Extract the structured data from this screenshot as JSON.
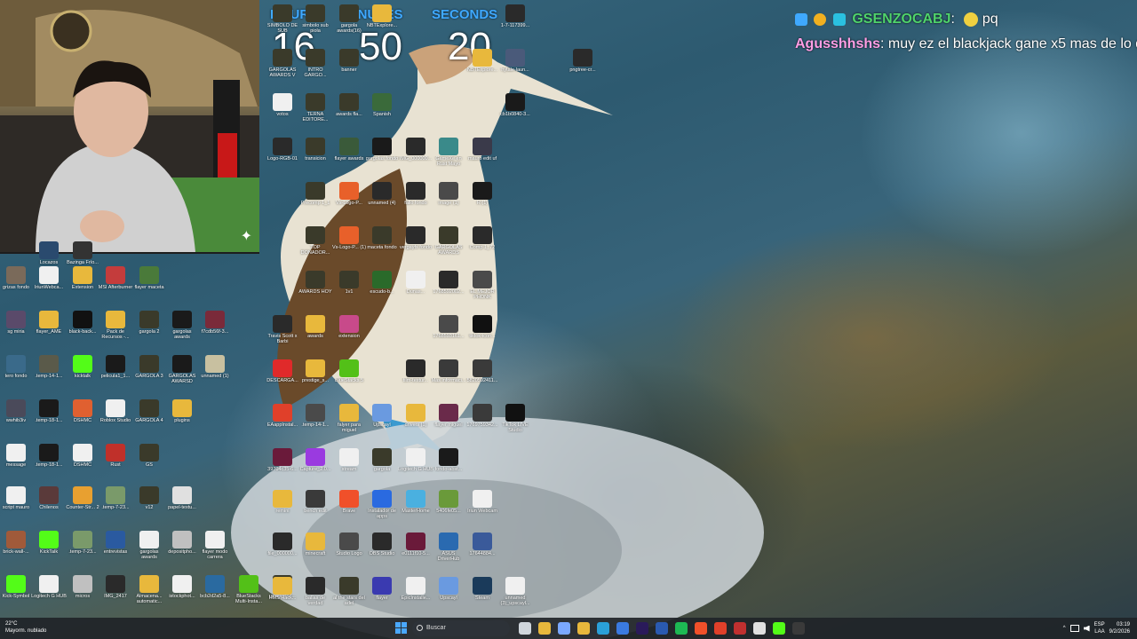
{
  "timer": {
    "hours_label": "HOURS",
    "minutes_label": "MINUTES",
    "seconds_label": "SECONDS",
    "hours": "16",
    "minutes": "50",
    "seconds": "20"
  },
  "chat": [
    {
      "user": "GSENZOCABJ",
      "sep": ":",
      "text": " pq",
      "badge_color": "#3fa9ff"
    },
    {
      "user": "Agusshhshs",
      "sep": ":",
      "text": " muy ez el blackjack gane x5 mas de lo que",
      "badge_color": ""
    }
  ],
  "webcam": {
    "sparkle": "✦"
  },
  "desktop_icons": [
    {
      "label": "Locazos",
      "color": "#2a4a6e"
    },
    {
      "label": "Bazinga Frío...",
      "color": "#333333"
    },
    {
      "label": "grizas fondo",
      "color": "#7a6a5a"
    },
    {
      "label": "IriunWebca...",
      "color": "#f0f0f0"
    },
    {
      "label": "Extension",
      "color": "#e8b83c"
    },
    {
      "label": "MSI Afterburner",
      "color": "#c43c3c"
    },
    {
      "label": "flayer maceta",
      "color": "#4a7a3a"
    },
    {
      "label": "sg miria",
      "color": "#5a4a6a"
    },
    {
      "label": "flayer_AME",
      "color": "#e8b83c"
    },
    {
      "label": "black-back...",
      "color": "#111111"
    },
    {
      "label": "Pack de Recursos -...",
      "color": "#e8b83c"
    },
    {
      "label": "gargola 2",
      "color": "#3a3a2a"
    },
    {
      "label": "gargolas awards",
      "color": "#1a1a1a"
    },
    {
      "label": "f7cdb56f-3...",
      "color": "#7a2a3a"
    },
    {
      "label": "tero fondo",
      "color": "#3a6a8a"
    },
    {
      "label": ".temp-14-1...",
      "color": "#5a5a4a"
    },
    {
      "label": "kicktalk",
      "color": "#53fc18"
    },
    {
      "label": "pelicula1_1...",
      "color": "#1a1a1a"
    },
    {
      "label": "GARGOLA 3",
      "color": "#3a3a2a"
    },
    {
      "label": "GARGOLAS AWARSD",
      "color": "#1a1a1a"
    },
    {
      "label": "unnamed (1)",
      "color": "#c8c0a0"
    },
    {
      "label": "wwhib3iv",
      "color": "#4a4a5a"
    },
    {
      "label": ".temp-18-1...",
      "color": "#1a1a1a"
    },
    {
      "label": "DSHMC",
      "color": "#e06030"
    },
    {
      "label": "Roblox Studio",
      "color": "#f0f0f0"
    },
    {
      "label": "GARGOLA 4",
      "color": "#3a3a2a"
    },
    {
      "label": "plugins",
      "color": "#e8b83c"
    },
    {
      "label": "message",
      "color": "#f0f0f0"
    },
    {
      "label": ".temp-18-1...",
      "color": "#1a1a1a"
    },
    {
      "label": "DSHMC",
      "color": "#f0f0f0"
    },
    {
      "label": "Rust",
      "color": "#c0302a"
    },
    {
      "label": "GS",
      "color": "#3a3a2a"
    },
    {
      "label": "script mauro",
      "color": "#f0f0f0"
    },
    {
      "label": "Chilenos",
      "color": "#5a3a3a"
    },
    {
      "label": "Counter-Str... 2",
      "color": "#e8a030"
    },
    {
      "label": ".temp-7-23...",
      "color": "#7a9a6a"
    },
    {
      "label": "v12",
      "color": "#3a3a2a"
    },
    {
      "label": "papel-textu...",
      "color": "#e0e0e0"
    },
    {
      "label": "brick-wall-...",
      "color": "#a05a3a"
    },
    {
      "label": "KickTalk",
      "color": "#53fc18"
    },
    {
      "label": ".temp-7-23...",
      "color": "#7a9a6a"
    },
    {
      "label": "entrevistas",
      "color": "#2a5aa0"
    },
    {
      "label": "gargolas awards",
      "color": "#f0f0f0"
    },
    {
      "label": "depositpho...",
      "color": "#c0c0c0"
    },
    {
      "label": "flayer modo carrera",
      "color": "#f0f0f0"
    },
    {
      "label": "Kick-Symbol",
      "color": "#53fc18"
    },
    {
      "label": "Logitech G HUB",
      "color": "#f0f0f0"
    },
    {
      "label": "micros",
      "color": "#c0c0c0"
    },
    {
      "label": "IMG_2417",
      "color": "#2a2a2a"
    },
    {
      "label": "Almacena... automatic...",
      "color": "#e8b83c"
    },
    {
      "label": "istockphot...",
      "color": "#f0f0f0"
    },
    {
      "label": "bcb2d2a5-8...",
      "color": "#2a6aa0"
    },
    {
      "label": "BlueStacks Multi-Insta...",
      "color": "#53c018"
    },
    {
      "label": "upscale_2...",
      "color": "#3a3a2a"
    },
    {
      "label": "SIMBOLO DE SUB",
      "color": "#3a3a2a"
    },
    {
      "label": "simbolo sub piola",
      "color": "#3a3a2a"
    },
    {
      "label": "gargola awards(16)",
      "color": "#3a3a2a"
    },
    {
      "label": "NBTExplore...",
      "color": "#e8b83c"
    },
    {
      "label": "1-7-117399...",
      "color": "#2a2a2a"
    },
    {
      "label": "GARGOLAS AWARDS V",
      "color": "#3a3a2a"
    },
    {
      "label": "INTRO GARGO...",
      "color": "#3a3a2a"
    },
    {
      "label": "banner",
      "color": "#3a3a2a"
    },
    {
      "label": "NBTExplore...",
      "color": "#e8b83c"
    },
    {
      "label": "hytale-laun...",
      "color": "#4a5a7a"
    },
    {
      "label": "pngtree-cr...",
      "color": "#2a2a2a"
    },
    {
      "label": "votos",
      "color": "#f0f0f0"
    },
    {
      "label": "TERNA EDITORE...",
      "color": "#3a3a2a"
    },
    {
      "label": "awards fla...",
      "color": "#3a3a2a"
    },
    {
      "label": "Spanish",
      "color": "#3a6a3a"
    },
    {
      "label": "cb1b0840-3...",
      "color": "#1a1a1a"
    },
    {
      "label": "Logo-RGB-01",
      "color": "#2a2a2a"
    },
    {
      "label": "transicion",
      "color": "#3a3a2a"
    },
    {
      "label": "flayer awards",
      "color": "#3a5a3a"
    },
    {
      "label": "gargolas fondo",
      "color": "#1a1a1a"
    },
    {
      "label": "IMG_000000...",
      "color": "#2a2a2a"
    },
    {
      "label": "GameXe en Rust Mayo",
      "color": "#3a8a8a"
    },
    {
      "label": "mauro edit uf",
      "color": "#3a3a4a"
    },
    {
      "label": "Precomp 1_1",
      "color": "#3a3a2a"
    },
    {
      "label": "Vs-Logo-P...",
      "color": "#e8602a"
    },
    {
      "label": "unnamed (4)",
      "color": "#2a2a2a"
    },
    {
      "label": "fallo fondo",
      "color": "#2a2a2a"
    },
    {
      "label": "image (1)",
      "color": "#4a4a4a"
    },
    {
      "label": "R (1)",
      "color": "#1a1a1a"
    },
    {
      "label": "TOP DONADOR...",
      "color": "#3a3a2a"
    },
    {
      "label": "Vs-Logo-P... (1)",
      "color": "#e8602a"
    },
    {
      "label": "maceta fondo",
      "color": "#3a3a2a"
    },
    {
      "label": "vergayfs fondo",
      "color": "#2a2a2a"
    },
    {
      "label": "GARGOLAS AWARDS",
      "color": "#3a3a2a"
    },
    {
      "label": "Comp 1_72",
      "color": "#2a2a2a"
    },
    {
      "label": "AWARDS HOY",
      "color": "#3a3a2a"
    },
    {
      "label": "1v1",
      "color": "#3a3a2a"
    },
    {
      "label": "escudo-b...",
      "color": "#2a6a2a"
    },
    {
      "label": "Dunas...",
      "color": "#f0f0f0"
    },
    {
      "label": "1768592002...",
      "color": "#2a2a2a"
    },
    {
      "label": "EL MEJOR PHONK",
      "color": "#4a4a4a"
    },
    {
      "label": "Travis Scott x Barbi",
      "color": "#2a2a2a"
    },
    {
      "label": "awards",
      "color": "#e8b83c"
    },
    {
      "label": "extension",
      "color": "#c84a8a"
    },
    {
      "label": "1768593161...",
      "color": "#4a4a4a"
    },
    {
      "label": "tiktok-icon...",
      "color": "#111111"
    },
    {
      "label": "DESCARGA...",
      "color": "#e02a2a"
    },
    {
      "label": "prestige_s...",
      "color": "#e8b83c"
    },
    {
      "label": "BlueStacks 5",
      "color": "#53c018"
    },
    {
      "label": "film-textur...",
      "color": "#2a2a2a"
    },
    {
      "label": "Más informaci...",
      "color": "#3a3a3a"
    },
    {
      "label": "5820592411...",
      "color": "#3a3a3a"
    },
    {
      "label": "EAappInstal...",
      "color": "#e0402a"
    },
    {
      "label": ".temp-14-1...",
      "color": "#4a4a4a"
    },
    {
      "label": "falyer para miguel",
      "color": "#e8b83c"
    },
    {
      "label": "Upscayl",
      "color": "#6a9ae0"
    },
    {
      "label": "drivers (1)",
      "color": "#e8b83c"
    },
    {
      "label": "flayer miguel",
      "color": "#6a2a4a"
    },
    {
      "label": "1769759342...",
      "color": "#3a3a3a"
    },
    {
      "label": "TikTok LIVE Studio",
      "color": "#111111"
    },
    {
      "label": "39704c35-6...",
      "color": "#6a1a3a"
    },
    {
      "label": "Capture_2.0...",
      "color": "#9a3ae0"
    },
    {
      "label": "stream",
      "color": "#f0f0f0"
    },
    {
      "label": "gargola",
      "color": "#3a3a2a"
    },
    {
      "label": "Logitech G HUB",
      "color": "#f0f0f0"
    },
    {
      "label": "fondo-abst...",
      "color": "#1a1a1a"
    },
    {
      "label": "remini",
      "color": "#e8b83c"
    },
    {
      "label": "bench edit",
      "color": "#3a3a3a"
    },
    {
      "label": "Brave",
      "color": "#f0502a"
    },
    {
      "label": "Instalador de apps",
      "color": "#2a6ae0"
    },
    {
      "label": "MasterHome",
      "color": "#4ab0e0"
    },
    {
      "label": "5406fe05...",
      "color": "#6a9a3a"
    },
    {
      "label": "Iriun Webcam",
      "color": "#f0f0f0"
    },
    {
      "label": "file_000000...",
      "color": "#2a2a2a"
    },
    {
      "label": "minecraft",
      "color": "#e8b83c"
    },
    {
      "label": "Studio Logo",
      "color": "#4a4a4a"
    },
    {
      "label": "OBS Studio",
      "color": "#2a2a2a"
    },
    {
      "label": "e0111f10-5...",
      "color": "#6a1a3a"
    },
    {
      "label": "ASUS DriverHub",
      "color": "#2a6ab0"
    },
    {
      "label": "17644884...",
      "color": "#3a5a9a"
    },
    {
      "label": "HMS Hack...",
      "color": "#e8b83c"
    },
    {
      "label": "ballas de verdad",
      "color": "#2a2a2a"
    },
    {
      "label": "al the stars del adel",
      "color": "#3a3a2a"
    },
    {
      "label": "flayer",
      "color": "#3a3ab0"
    },
    {
      "label": "EpicInstalle...",
      "color": "#f0f0f0"
    },
    {
      "label": "Upscayl",
      "color": "#6a9ae0"
    },
    {
      "label": "Steam",
      "color": "#1a3a5a"
    },
    {
      "label": "unnamed (3)_upscayl...",
      "color": "#f0f0f0"
    },
    {
      "label": "CurseForge Installer",
      "color": "#f0f0f0"
    },
    {
      "label": "camisetas gargolas",
      "color": "#e8b83c"
    }
  ],
  "taskbar": {
    "weather_temp": "22°C",
    "weather_desc": "Mayorm. nublado",
    "search_placeholder": "Buscar",
    "lang_1": "ESP",
    "lang_2": "LAA",
    "time": "03:19",
    "date": "9/2/2026",
    "apps": [
      {
        "name": "task-view-icon",
        "color": "#cfd6dc"
      },
      {
        "name": "file-explorer-icon",
        "color": "#e8b83c"
      },
      {
        "name": "copilot-icon",
        "color": "#7aa8ff"
      },
      {
        "name": "folder-icon",
        "color": "#e8b83c"
      },
      {
        "name": "edge-icon",
        "color": "#2aa0d8"
      },
      {
        "name": "store-icon",
        "color": "#3a7ae0"
      },
      {
        "name": "premiere-icon",
        "color": "#2a1a5a"
      },
      {
        "name": "word-icon",
        "color": "#2a5ab0"
      },
      {
        "name": "spotify-icon",
        "color": "#1db954"
      },
      {
        "name": "brave-icon",
        "color": "#f0502a"
      },
      {
        "name": "chrome-icon",
        "color": "#e0402a"
      },
      {
        "name": "app-red-icon",
        "color": "#c03030"
      },
      {
        "name": "capcut-icon",
        "color": "#e0e0e0"
      },
      {
        "name": "kick-icon",
        "color": "#53fc18"
      },
      {
        "name": "obs-icon",
        "color": "#3a3a3a"
      }
    ]
  }
}
